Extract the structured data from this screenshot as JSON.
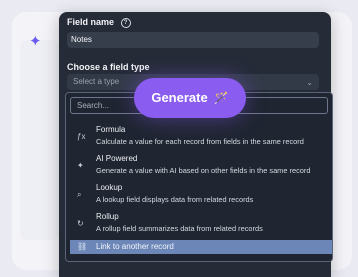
{
  "form": {
    "field_name_label": "Field name",
    "field_name_value": "Notes",
    "field_type_label": "Choose a field type",
    "field_type_placeholder": "Select a type"
  },
  "dropdown": {
    "search_placeholder": "Search...",
    "items": [
      {
        "icon": "formula-icon",
        "glyph": "ƒx",
        "title": "Formula",
        "description": "Calculate a value for each record from fields in the same record"
      },
      {
        "icon": "ai-sparkle-icon",
        "glyph": "✦",
        "title": "AI Powered",
        "description": "Generate a value with AI based on other fields in the same record"
      },
      {
        "icon": "lookup-icon",
        "glyph": "⌕",
        "title": "Lookup",
        "description": "A lookup field displays data from related records"
      },
      {
        "icon": "rollup-icon",
        "glyph": "↻",
        "title": "Rollup",
        "description": "A rollup field summarizes data from related records"
      },
      {
        "icon": "link-icon",
        "glyph": "⛓",
        "title": "Link to another record",
        "description": ""
      }
    ]
  },
  "generate_button": {
    "label": "Generate",
    "icon": "magic-wand-icon"
  },
  "colors": {
    "panel": "#252b37",
    "accent": "#8a5cf0",
    "highlight": "#6c86b7"
  }
}
